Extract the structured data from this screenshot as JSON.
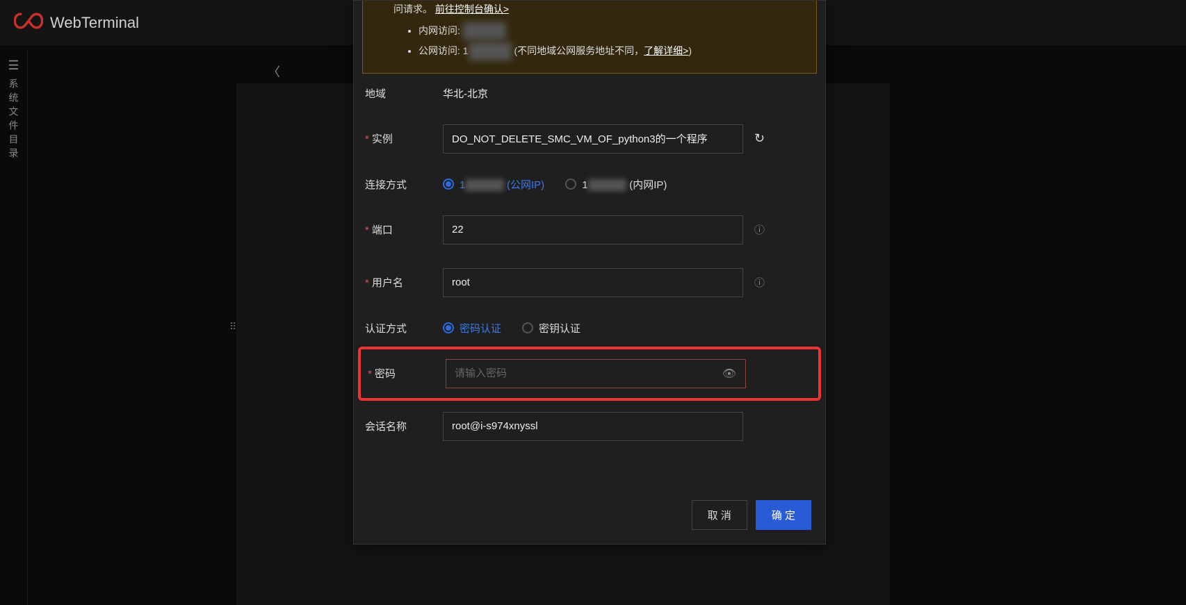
{
  "header": {
    "brand": "WebTerminal"
  },
  "sidebar": {
    "label": "系统文件目录"
  },
  "notice": {
    "line1_prefix": "问请求。",
    "link1": "前往控制台确认>",
    "bullet1_label": "内网访问: ",
    "bullet2_label": "公网访问: 1",
    "bullet2_suffix": "(不同地域公网服务地址不同，",
    "link2": "了解详细>",
    "bullet2_close": ")"
  },
  "form": {
    "region_label": "地域",
    "region_value": "华北-北京",
    "instance_label": "实例",
    "instance_value": "DO_NOT_DELETE_SMC_VM_OF_python3的一个程序",
    "conn_label": "连接方式",
    "conn_public_prefix": "1",
    "conn_public_suffix": "(公网IP)",
    "conn_private_prefix": "1",
    "conn_private_suffix": "(内网IP)",
    "port_label": "端口",
    "port_value": "22",
    "user_label": "用户名",
    "user_value": "root",
    "auth_label": "认证方式",
    "auth_pwd": "密码认证",
    "auth_key": "密钥认证",
    "pwd_label": "密码",
    "pwd_placeholder": "请输入密码",
    "session_label": "会话名称",
    "session_value": "root@i-s974xnyssl"
  },
  "footer": {
    "cancel": "取 消",
    "confirm": "确 定"
  }
}
